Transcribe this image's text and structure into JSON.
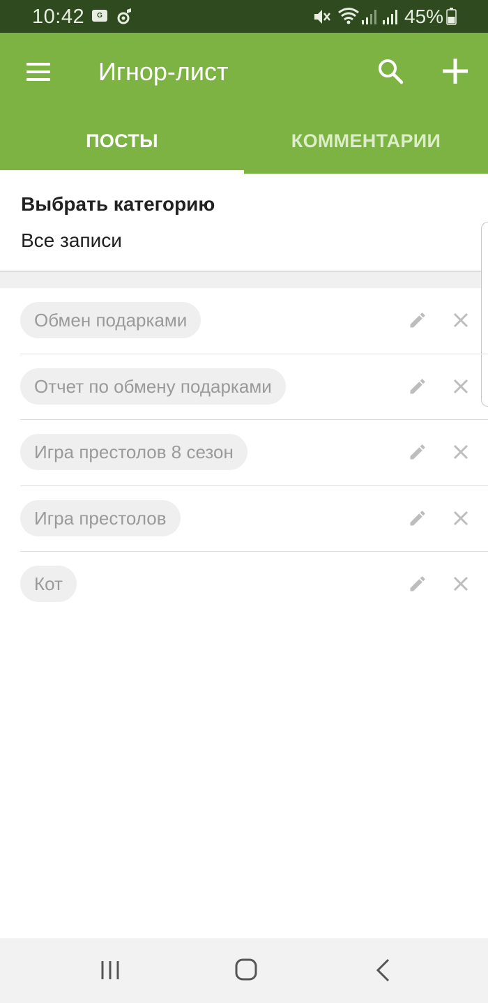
{
  "status_bar": {
    "time": "10:42",
    "battery": "45%",
    "icons": [
      "gallery-icon",
      "music-icon",
      "mute-icon",
      "wifi-icon",
      "signal-icon",
      "signal-icon",
      "battery-icon"
    ]
  },
  "app_bar": {
    "title": "Игнор-лист",
    "background": "#7cb342"
  },
  "tabs": [
    {
      "label": "ПОСТЫ",
      "active": true
    },
    {
      "label": "КОММЕНТАРИИ",
      "active": false
    }
  ],
  "category": {
    "title": "Выбрать категорию",
    "value": "Все записи"
  },
  "ignore_list": [
    {
      "label": "Обмен подарками"
    },
    {
      "label": "Отчет по обмену подарками"
    },
    {
      "label": "Игра престолов 8 сезон"
    },
    {
      "label": "Игра престолов"
    },
    {
      "label": "Кот"
    }
  ],
  "nav_bar": {
    "icons": [
      "recent-apps-icon",
      "home-icon",
      "back-icon"
    ]
  }
}
